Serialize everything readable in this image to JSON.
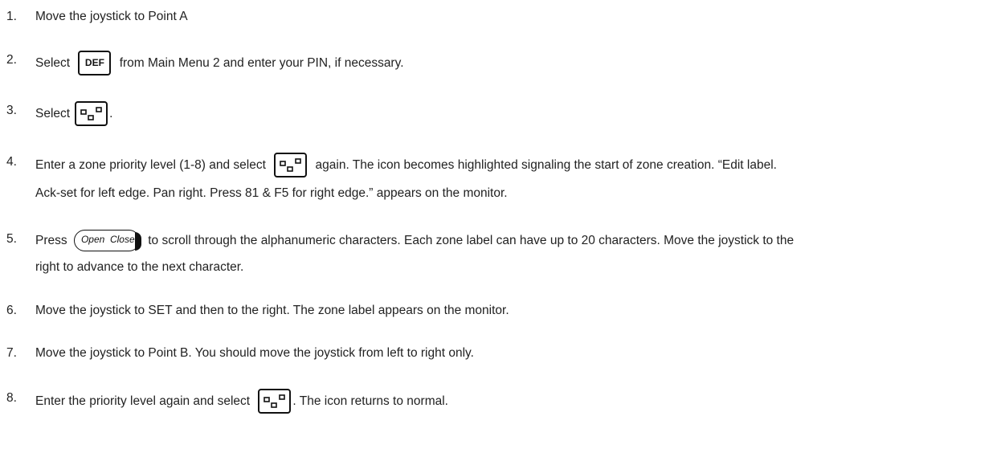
{
  "steps": [
    {
      "n": "1.",
      "text": "Move the joystick to Point A"
    },
    {
      "n": "2.",
      "pre": "Select",
      "key": "DEF",
      "post": "from Main Menu 2 and enter your PIN, if necessary."
    },
    {
      "n": "3.",
      "pre": "Select",
      "post": "."
    },
    {
      "n": "4.",
      "pre": "Enter a zone priority level (1-8) and select",
      "post": "again. The icon becomes highlighted signaling the start of zone creation. “Edit label.",
      "line2": "Ack-set for left edge. Pan right. Press 81 & F5 for right edge.” appears on the monitor."
    },
    {
      "n": "5.",
      "pre": "Press",
      "key_open": "Open",
      "key_close": "Close",
      "post": "to scroll through the alphanumeric characters. Each zone label can have up to 20 characters. Move the joystick to the",
      "line2": "right to advance to the next character."
    },
    {
      "n": "6.",
      "text": "Move the joystick to SET and then to the right. The zone label appears on the monitor."
    },
    {
      "n": "7.",
      "text": "Move the joystick to Point B. You should move the joystick from left to right only."
    },
    {
      "n": "8.",
      "pre": "Enter the priority level again and select",
      "post": ". The icon returns to normal."
    }
  ]
}
